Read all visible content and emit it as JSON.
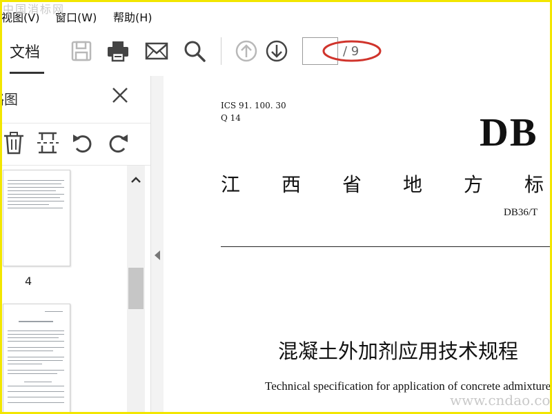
{
  "watermark": {
    "top": "中国消标网",
    "bottom": "www.cndao.com"
  },
  "menubar": {
    "items": [
      "视图(V)",
      "窗口(W)",
      "帮助(H)"
    ]
  },
  "toolbar": {
    "tab_label": "文档",
    "page_input_value": "",
    "page_total": "/ 9",
    "icons": [
      "save-icon",
      "print-icon",
      "mail-icon",
      "search-icon",
      "arrow-up-icon",
      "arrow-down-icon"
    ],
    "annotation_color": "#d0342c"
  },
  "leftpanel": {
    "title": "缩略图",
    "tools": [
      "trash-icon",
      "crop-icon",
      "rotate-left-icon",
      "rotate-right-icon"
    ],
    "thumbnails": [
      {
        "page_label": "4"
      }
    ]
  },
  "document": {
    "ics": "ICS  91. 100. 30",
    "q": "Q  14",
    "db": "DB",
    "region_chars": [
      "江",
      "西",
      "省",
      "地",
      "方",
      "标"
    ],
    "std_code": "DB36/T",
    "title_cn": "混凝土外加剂应用技术规程",
    "title_en": "Technical specification for application of concrete admixture"
  },
  "colors": {
    "frame": "#f2e600",
    "icon_active": "#444444",
    "icon_disabled": "#b8b8b8"
  }
}
